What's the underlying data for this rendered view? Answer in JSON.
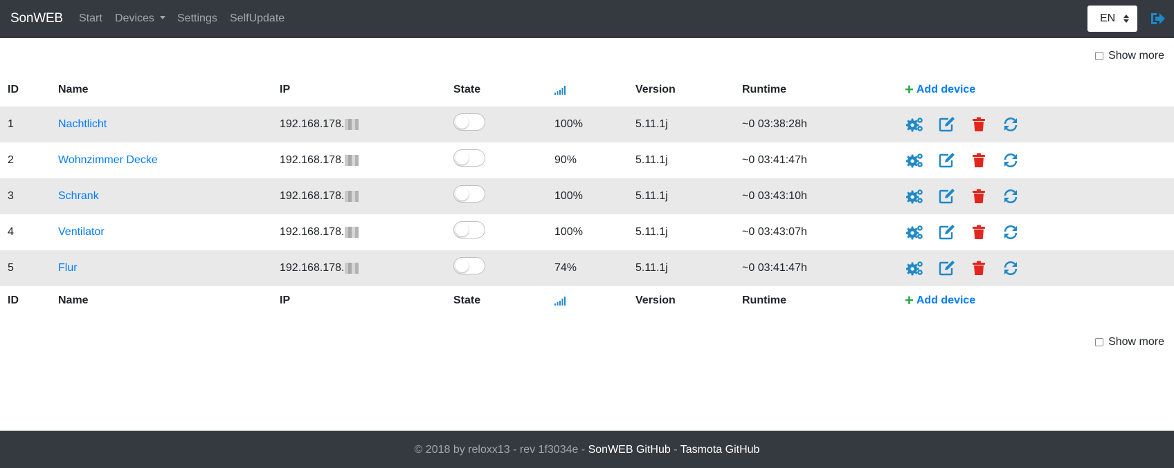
{
  "navbar": {
    "brand": "SonWEB",
    "links": {
      "start": "Start",
      "devices": "Devices",
      "settings": "Settings",
      "selfupdate": "SelfUpdate"
    },
    "language": "EN"
  },
  "show_more_label": "Show more",
  "table": {
    "headers": {
      "id": "ID",
      "name": "Name",
      "ip": "IP",
      "state": "State",
      "version": "Version",
      "runtime": "Runtime"
    },
    "add_device": "Add device",
    "rows": [
      {
        "id": "1",
        "name": "Nachtlicht",
        "ip": "192.168.178.",
        "state": "off",
        "signal": "100%",
        "version": "5.11.1j",
        "runtime": "~0 03:38:28h"
      },
      {
        "id": "2",
        "name": "Wohnzimmer Decke",
        "ip": "192.168.178.",
        "state": "off",
        "signal": "90%",
        "version": "5.11.1j",
        "runtime": "~0 03:41:47h"
      },
      {
        "id": "3",
        "name": "Schrank",
        "ip": "192.168.178.",
        "state": "off",
        "signal": "100%",
        "version": "5.11.1j",
        "runtime": "~0 03:43:10h"
      },
      {
        "id": "4",
        "name": "Ventilator",
        "ip": "192.168.178.",
        "state": "off",
        "signal": "100%",
        "version": "5.11.1j",
        "runtime": "~0 03:43:07h"
      },
      {
        "id": "5",
        "name": "Flur",
        "ip": "192.168.178.",
        "state": "off",
        "signal": "74%",
        "version": "5.11.1j",
        "runtime": "~0 03:41:47h"
      }
    ],
    "row_actions": [
      "config-icon",
      "edit-icon",
      "delete-icon",
      "refresh-icon"
    ]
  },
  "footer": {
    "copyright": "© 2018 by reloxx13 - rev 1f3034e - ",
    "separator": " - ",
    "sonweb_github": "SonWEB GitHub",
    "tasmota_github": "Tasmota GitHub"
  },
  "colors": {
    "navbar": "#343a40",
    "link": "#007bff",
    "icon_blue": "#1e88c9",
    "delete_red": "#e3261d",
    "add_green": "#28a745",
    "stripe": "#e9e9e9"
  }
}
